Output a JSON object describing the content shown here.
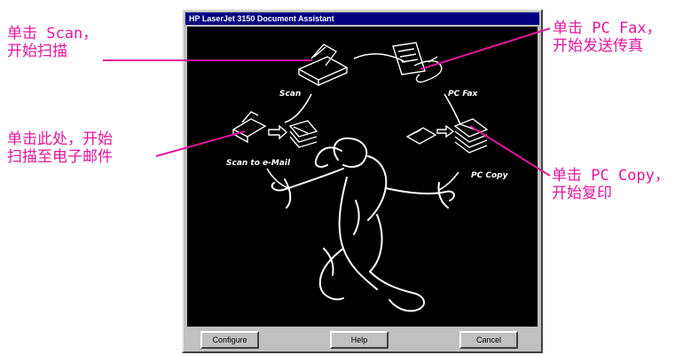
{
  "window": {
    "title": "HP LaserJet 3150 Document Assistant",
    "icons": {
      "scan": "Scan",
      "pc_fax": "PC Fax",
      "scan_to_email": "Scan to e-Mail",
      "pc_copy": "PC Copy"
    },
    "buttons": {
      "configure": "Configure",
      "help": "Help",
      "cancel": "Cancel"
    }
  },
  "callouts": {
    "scan": [
      "单击 Scan，",
      "开始扫描"
    ],
    "pc_fax": [
      "单击 PC Fax，",
      "开始发送传真"
    ],
    "scan_to_email": [
      "单击此处，开始",
      "扫描至电子邮件"
    ],
    "pc_copy": [
      "单击 PC Copy，",
      "开始复印"
    ]
  },
  "colors": {
    "callout": "#e0179c",
    "titlebar": "#000080",
    "window": "#c0c0c0",
    "canvas": "#000000"
  }
}
